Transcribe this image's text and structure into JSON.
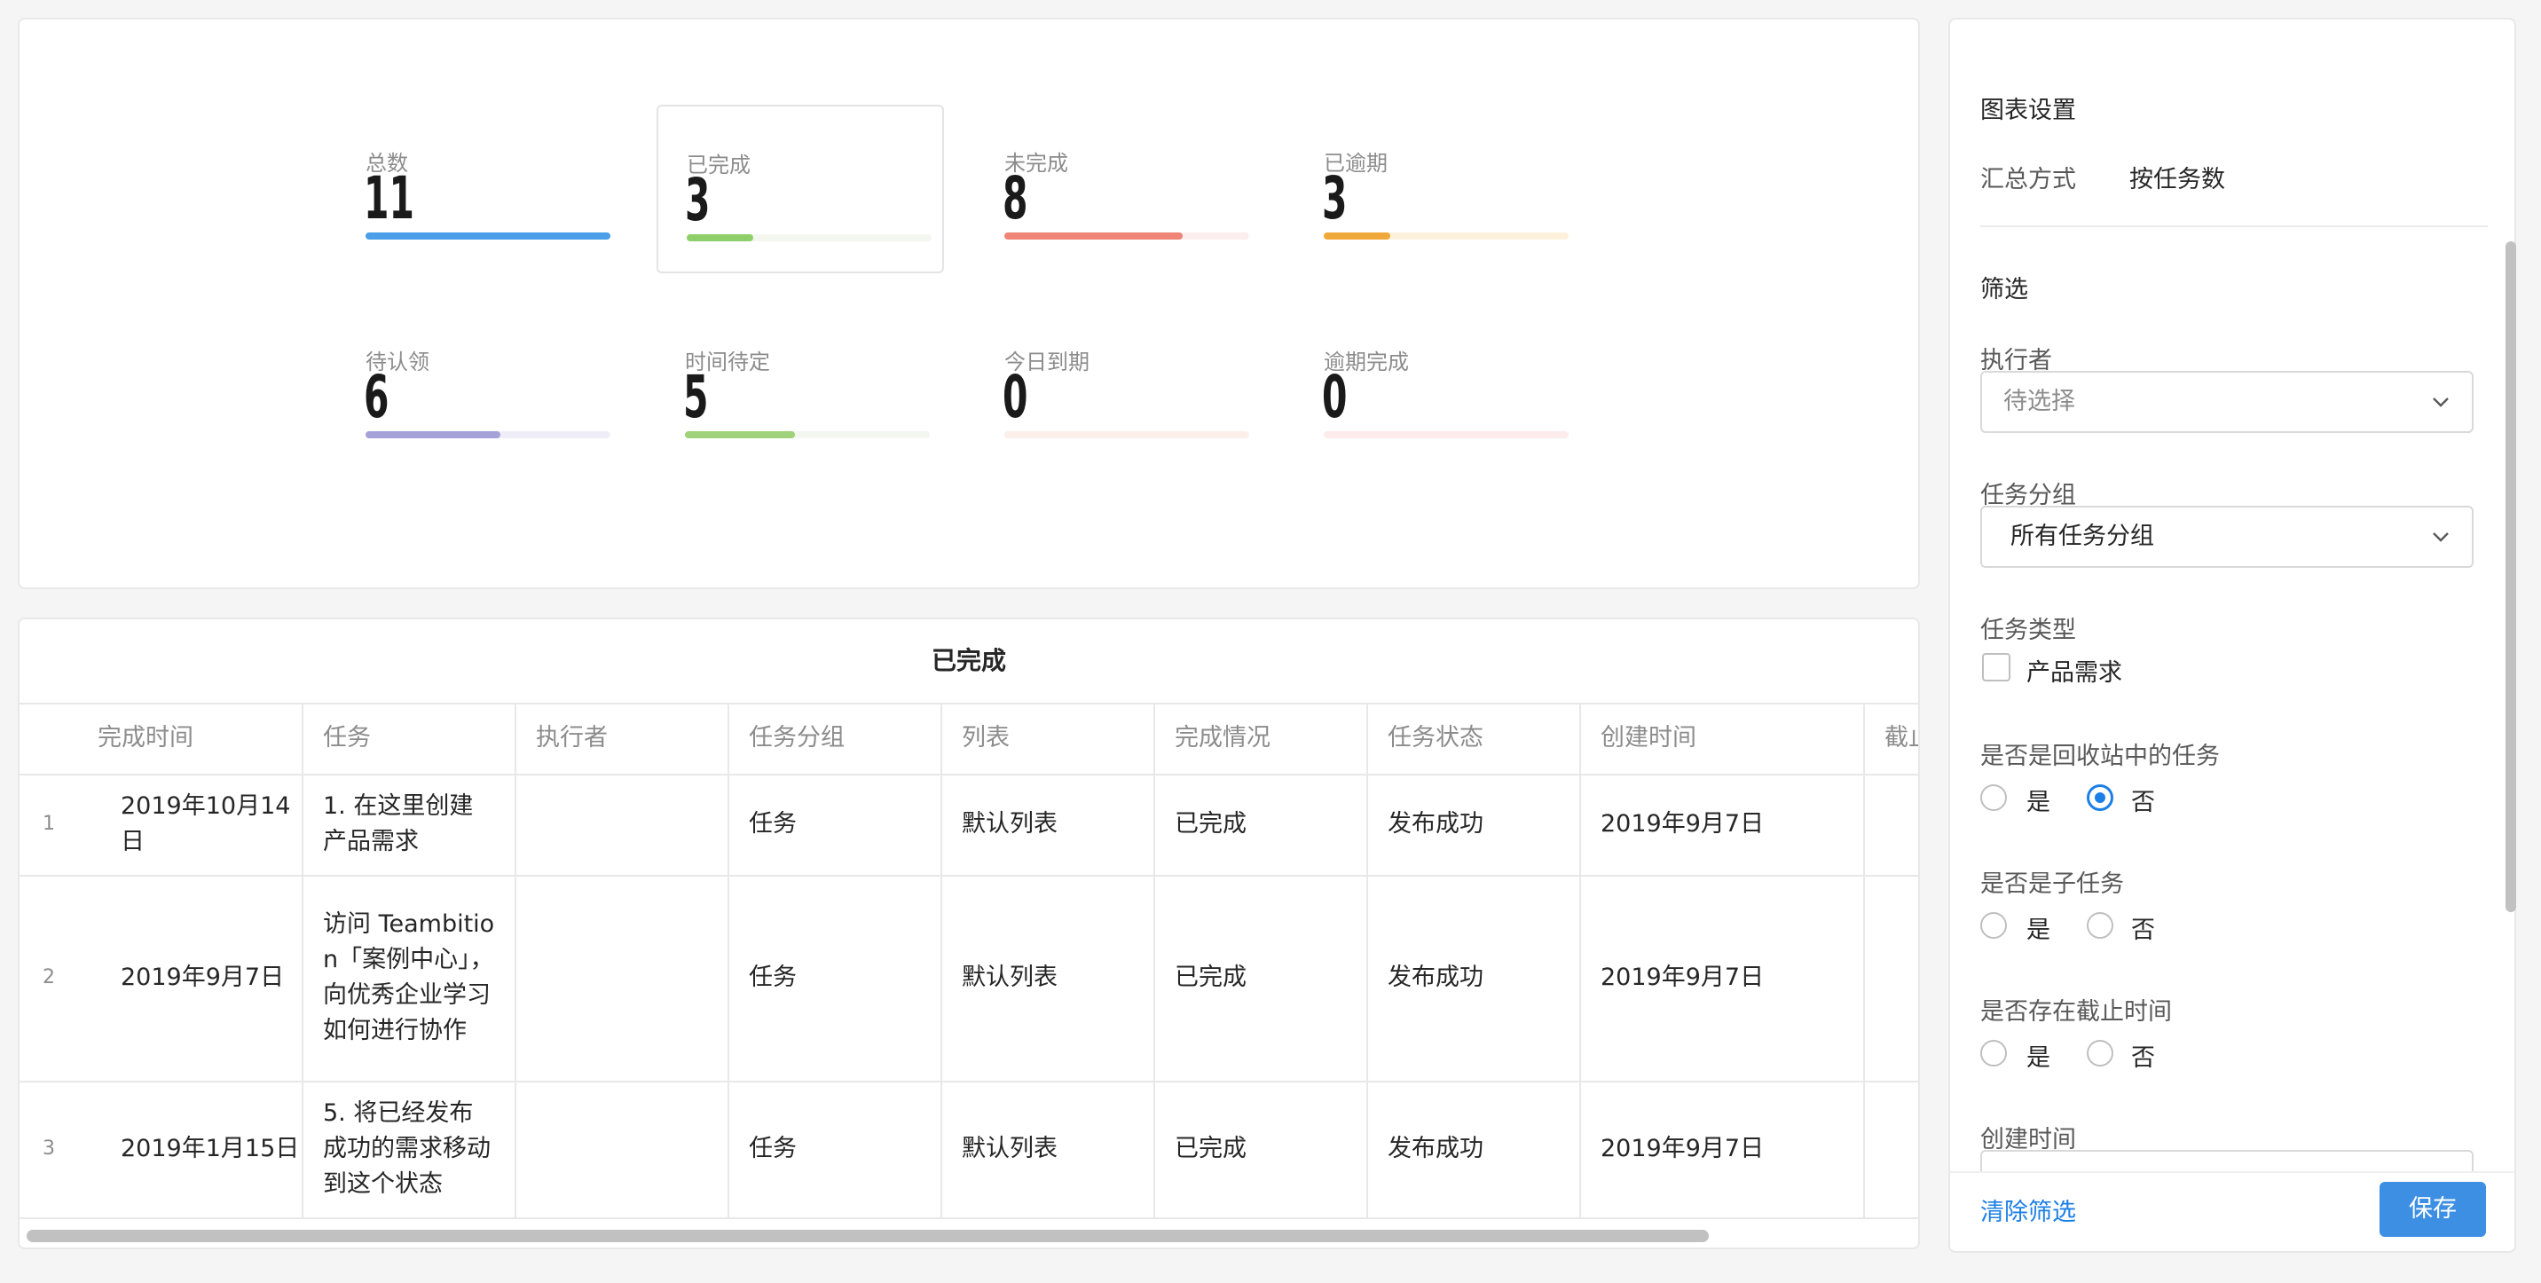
{
  "stats": [
    {
      "label": "总数",
      "value": "11",
      "progress": 1.0,
      "fill": "#4b9fe8",
      "track": "#eaf2fb"
    },
    {
      "label": "已完成",
      "value": "3",
      "progress": 0.27,
      "fill": "#8fcf6a",
      "track": "#f3f7ef"
    },
    {
      "label": "未完成",
      "value": "8",
      "progress": 0.73,
      "fill": "#ee8577",
      "track": "#fbeeec"
    },
    {
      "label": "已逾期",
      "value": "3",
      "progress": 0.27,
      "fill": "#f0a83a",
      "track": "#fdf1dc"
    },
    {
      "label": "待认领",
      "value": "6",
      "progress": 0.55,
      "fill": "#a5a2d8",
      "track": "#efeef8"
    },
    {
      "label": "时间待定",
      "value": "5",
      "progress": 0.45,
      "fill": "#9fd27a",
      "track": "#f3f7ef"
    },
    {
      "label": "今日到期",
      "value": "0",
      "progress": 0.0,
      "fill": "#f3c9b7",
      "track": "#fbefe9"
    },
    {
      "label": "逾期完成",
      "value": "0",
      "progress": 0.0,
      "fill": "#f4c2c2",
      "track": "#fcecec"
    }
  ],
  "table": {
    "title": "已完成",
    "columns": [
      "完成时间",
      "任务",
      "执行者",
      "任务分组",
      "列表",
      "完成情况",
      "任务状态",
      "创建时间",
      "截止"
    ],
    "rows": [
      {
        "num": "1",
        "cells": [
          "2019年10月14日",
          "1. 在这里创建产品需求",
          "",
          "任务",
          "默认列表",
          "已完成",
          "发布成功",
          "2019年9月7日",
          ""
        ]
      },
      {
        "num": "2",
        "cells": [
          "2019年9月7日",
          "访问 Teambition「案例中心」，向优秀企业学习如何进行协作",
          "",
          "任务",
          "默认列表",
          "已完成",
          "发布成功",
          "2019年9月7日",
          ""
        ]
      },
      {
        "num": "3",
        "cells": [
          "2019年1月15日",
          "5. 将已经发布成功的需求移动到这个状态",
          "",
          "任务",
          "默认列表",
          "已完成",
          "发布成功",
          "2019年9月7日",
          ""
        ]
      }
    ]
  },
  "settings": {
    "title": "图表设置",
    "summary_label": "汇总方式",
    "summary_value": "按任务数",
    "filter_title": "筛选",
    "executor_label": "执行者",
    "executor_placeholder": "待选择",
    "group_label": "任务分组",
    "group_value": "所有任务分组",
    "type_label": "任务类型",
    "type_option": "产品需求",
    "recycle_label": "是否是回收站中的任务",
    "subtask_label": "是否是子任务",
    "deadline_label": "是否存在截止时间",
    "yes": "是",
    "no": "否",
    "created_label": "创建时间",
    "clear_label": "清除筛选",
    "save_label": "保存"
  }
}
